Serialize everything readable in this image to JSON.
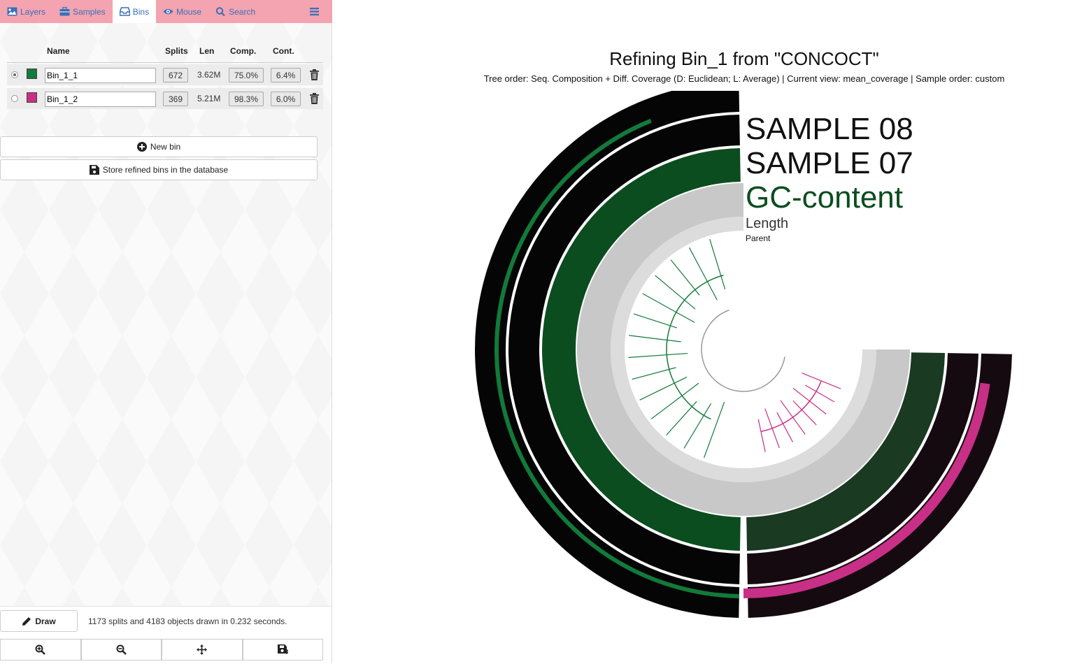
{
  "tabs": [
    {
      "label": "Layers",
      "icon": "image-icon"
    },
    {
      "label": "Samples",
      "icon": "briefcase-icon"
    },
    {
      "label": "Bins",
      "icon": "inbox-icon"
    },
    {
      "label": "Mouse",
      "icon": "eye-icon"
    },
    {
      "label": "Search",
      "icon": "search-icon"
    }
  ],
  "menu_icon": "hamburger-menu-icon",
  "bins": {
    "headers": {
      "name": "Name",
      "splits": "Splits",
      "len": "Len",
      "comp": "Comp.",
      "cont": "Cont."
    },
    "rows": [
      {
        "selected": true,
        "color": "#127a3a",
        "name": "Bin_1_1",
        "splits": "672",
        "len": "3.62M",
        "comp": "75.0%",
        "cont": "6.4%"
      },
      {
        "selected": false,
        "color": "#c82f86",
        "name": "Bin_1_2",
        "splits": "369",
        "len": "5.21M",
        "comp": "98.3%",
        "cont": "6.0%"
      }
    ],
    "new_bin_label": "New bin",
    "store_label": "Store refined bins in the database"
  },
  "footer": {
    "draw_label": "Draw",
    "status": "1173 splits and 4183 objects drawn in 0.232 seconds.",
    "tools": [
      "zoom-in-icon",
      "zoom-out-icon",
      "center-icon",
      "save-icon"
    ]
  },
  "figure": {
    "title": "Refining Bin_1 from \"CONCOCT\"",
    "subtitle": "Tree order: Seq. Composition + Diff. Coverage (D: Euclidean; L: Average) | Current view: mean_coverage | Sample order: custom",
    "layers": [
      "SAMPLE 08",
      "SAMPLE 07",
      "GC-content",
      "Length",
      "Parent"
    ],
    "colors": {
      "bin_1": "#127a3a",
      "bin_2": "#c82f86",
      "gc": "#0b4d1f",
      "sample": "#050505"
    }
  }
}
